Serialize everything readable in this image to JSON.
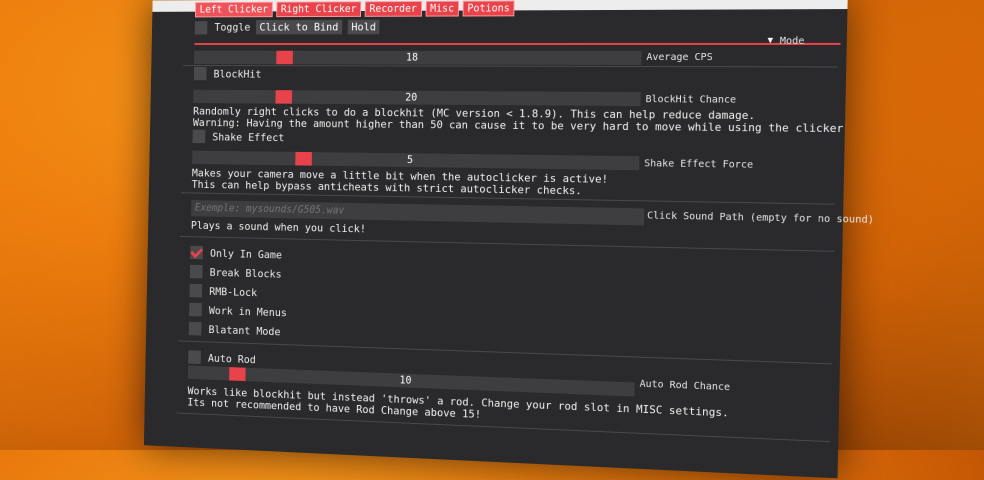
{
  "tabs": [
    "Left Clicker",
    "Right Clicker",
    "Recorder",
    "Misc",
    "Potions"
  ],
  "toggle": {
    "label": "Toggle",
    "bind_label": "Click to Bind",
    "mode_label": "Hold"
  },
  "cps": {
    "value": "18",
    "label": "Average CPS",
    "mode": "Mode",
    "fill": 0.2
  },
  "blockhit": {
    "label": "BlockHit",
    "chance_value": "20",
    "chance_label": "BlockHit Chance",
    "fill": 0.2,
    "desc1": "Randomly right clicks to do a blockhit (MC version < 1.8.9). This can help reduce damage.",
    "desc2": "Warning: Having the amount higher than 50 can cause it to be very hard to move while using the clicker"
  },
  "shake": {
    "label": "Shake Effect",
    "value": "5",
    "force_label": "Shake Effect Force",
    "fill": 0.25,
    "desc1": "Makes your camera move a little bit when the autoclicker is active!",
    "desc2": "This can help bypass anticheats with strict autoclicker checks."
  },
  "sound": {
    "placeholder": "Exemple: mysounds/G505.wav",
    "label": "Click Sound Path (empty for no sound)",
    "desc": "Plays a sound when you click!"
  },
  "options": [
    {
      "label": "Only In Game",
      "checked": true
    },
    {
      "label": "Break Blocks",
      "checked": false
    },
    {
      "label": "RMB-Lock",
      "checked": false
    },
    {
      "label": "Work in Menus",
      "checked": false
    },
    {
      "label": "Blatant Mode",
      "checked": false
    }
  ],
  "autorod": {
    "label": "Auto Rod",
    "value": "10",
    "chance_label": "Auto Rod Chance",
    "fill": 0.1,
    "desc1": "Works like blockhit but instead 'throws' a rod. Change your rod slot in MISC settings.",
    "desc2": "Its not recommended to have Rod Change above 15!"
  }
}
